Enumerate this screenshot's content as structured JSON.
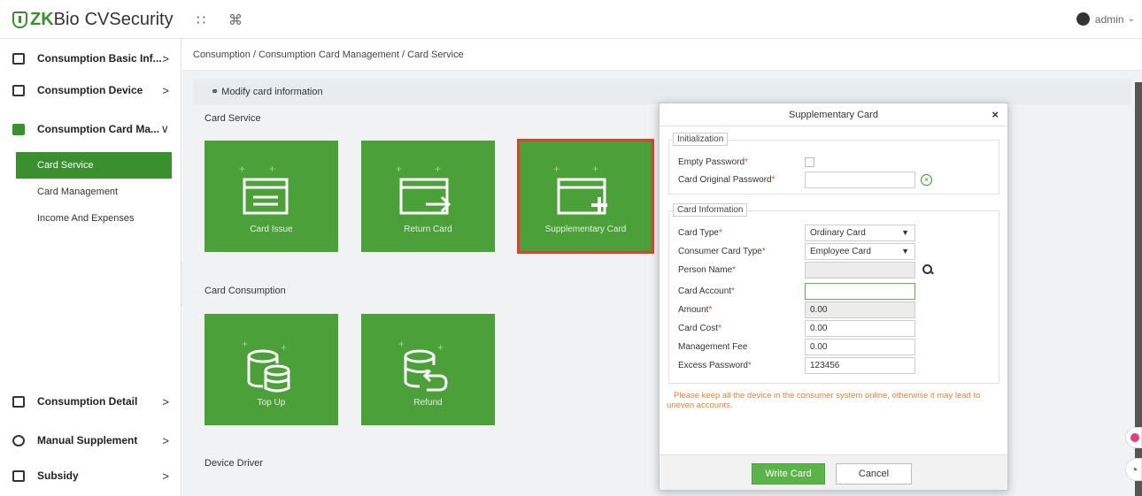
{
  "app": {
    "logo_zk": "ZK",
    "logo_bio": "Bio",
    "logo_name": "CVSecurity"
  },
  "topbar": {
    "grid_icon": "grid-icon",
    "cmd_icon": "command-icon",
    "user": "admin"
  },
  "sidebar": {
    "items": [
      {
        "label": "Consumption Basic Inf...",
        "arrow": ">"
      },
      {
        "label": "Consumption Device",
        "arrow": ">"
      },
      {
        "label": "Consumption Card Ma...",
        "arrow": "∨"
      },
      {
        "label": "Consumption Detail",
        "arrow": ">"
      },
      {
        "label": "Manual Supplement",
        "arrow": ">"
      },
      {
        "label": "Subsidy",
        "arrow": ">"
      }
    ],
    "sub_items": [
      {
        "label": "Card Service"
      },
      {
        "label": "Card Management"
      },
      {
        "label": "Income And Expenses"
      }
    ],
    "collapse": "«"
  },
  "main": {
    "breadcrumb": "Consumption / Consumption Card Management / Card Service",
    "modify": "Modify card information",
    "sections": {
      "card_service": "Card Service",
      "card_consumption": "Card Consumption",
      "device_driver": "Device Driver"
    },
    "tiles": {
      "card_issue": "Card Issue",
      "return_card": "Return Card",
      "supplementary_card": "Supplementary Card",
      "top_up": "Top Up",
      "refund": "Refund"
    }
  },
  "modal": {
    "title": "Supplementary Card",
    "close": "×",
    "init_legend": "Initialization",
    "empty_password": "Empty Password",
    "card_original_password": "Card Original Password",
    "card_info_legend": "Card Information",
    "card_type": {
      "label": "Card Type",
      "value": "Ordinary Card"
    },
    "consumer_card_type": {
      "label": "Consumer Card Type",
      "value": "Employee Card"
    },
    "person_name": {
      "label": "Person Name",
      "value": ""
    },
    "card_account": {
      "label": "Card Account",
      "value": ""
    },
    "amount": {
      "label": "Amount",
      "value": "0.00"
    },
    "card_cost": {
      "label": "Card Cost",
      "value": "0.00"
    },
    "management_fee": {
      "label": "Management Fee",
      "value": "0.00"
    },
    "excess_password": {
      "label": "Excess Password",
      "value": "123456"
    },
    "warning": "Please keep all the device in the consumer system online, otherwise it may lead to uneven accounts.",
    "write_card": "Write Card",
    "cancel": "Cancel",
    "required_mark": "*"
  },
  "colors": {
    "accent": "#3a8f2f",
    "tile": "#4ba03a",
    "selected_border": "#d9442c",
    "warning": "#e8803a"
  }
}
